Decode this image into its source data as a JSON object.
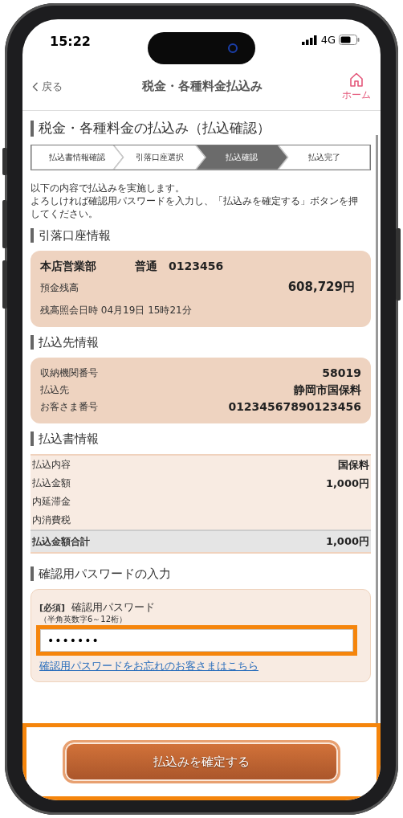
{
  "status_bar": {
    "time": "15:22",
    "network": "4G"
  },
  "header": {
    "back": "戻る",
    "title": "税金・各種料金払込み",
    "home": "ホーム"
  },
  "page_title": "税金・各種料金の払込み（払込確認）",
  "steps": [
    {
      "label": "払込書情報確認",
      "selected": false
    },
    {
      "label": "引落口座選択",
      "selected": false
    },
    {
      "label": "払込確認",
      "selected": true
    },
    {
      "label": "払込完了",
      "selected": false
    }
  ],
  "intro": [
    "以下の内容で払込みを実施します。",
    "よろしければ確認用パスワードを入力し、「払込みを確定する」ボタンを押してください。"
  ],
  "account": {
    "heading": "引落口座情報",
    "branch": "本店営業部",
    "type": "普通",
    "number": "0123456",
    "balance_label": "預金残高",
    "balance": "608,729円",
    "inquiry_label": "残高照会日時",
    "inquiry_time": "04月19日 15時21分"
  },
  "payee": {
    "heading": "払込先情報",
    "rows": [
      {
        "label": "収納機関番号",
        "value": "58019"
      },
      {
        "label": "払込先",
        "value": "静岡市国保料"
      },
      {
        "label": "お客さま番号",
        "value": "01234567890123456"
      }
    ]
  },
  "slip": {
    "heading": "払込書情報",
    "rows": [
      {
        "label": "払込内容",
        "value": "国保料"
      },
      {
        "label": "払込金額",
        "value": "1,000円"
      },
      {
        "label": "内延滞金"
      },
      {
        "label": "内消費税"
      }
    ],
    "total": {
      "label": "払込金額合計",
      "value": "1,000円"
    }
  },
  "password": {
    "heading": "確認用パスワードの入力",
    "required": "[必須]",
    "label": "確認用パスワード",
    "hint": "（半角英数字6～12桁）",
    "value": "•••••••",
    "highlighted": true,
    "forgot_link": "確認用パスワードをお忘れのお客さまはこちら"
  },
  "confirm": {
    "label": "払込みを確定する",
    "highlighted": true
  }
}
